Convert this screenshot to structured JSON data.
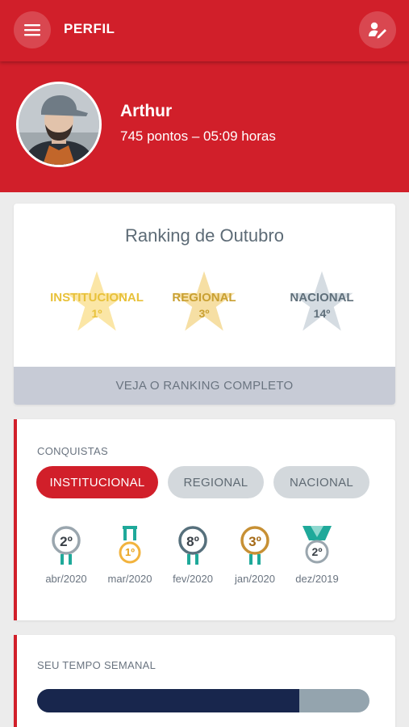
{
  "header": {
    "title": "PERFIL",
    "menu_icon": "hamburger-menu-icon",
    "edit_icon": "edit-profile-icon"
  },
  "profile": {
    "name": "Arthur",
    "stats": "745 pontos – 05:09 horas"
  },
  "ranking": {
    "title": "Ranking de Outubro",
    "items": [
      {
        "label": "INSTITUCIONAL",
        "position": "1º",
        "color": "#e8c13a"
      },
      {
        "label": "REGIONAL",
        "position": "3º",
        "color": "#c9a032"
      },
      {
        "label": "NACIONAL",
        "position": "14º",
        "color": "#6d7d88"
      }
    ],
    "button_label": "VEJA O RANKING COMPLETO"
  },
  "conquistas": {
    "title": "CONQUISTAS",
    "tabs": [
      {
        "label": "INSTITUCIONAL",
        "active": true
      },
      {
        "label": "REGIONAL",
        "active": false
      },
      {
        "label": "NACIONAL",
        "active": false
      }
    ],
    "medals": [
      {
        "rank": "2º",
        "date": "abr/2020",
        "ring": "#9aa6ae",
        "ribbon": "#1fa99a"
      },
      {
        "rank": "1º",
        "date": "mar/2020",
        "ring": "#f2b33d",
        "ribbon": "#1fa99a"
      },
      {
        "rank": "8º",
        "date": "fev/2020",
        "ring": "#56707c",
        "ribbon": "#1fa99a"
      },
      {
        "rank": "3º",
        "date": "jan/2020",
        "ring": "#c79034",
        "ribbon": "#1fa99a"
      },
      {
        "rank": "2º",
        "date": "dez/2019",
        "ring": "#9aa6ae",
        "ribbon": "#1fa99a"
      }
    ]
  },
  "tempo": {
    "title": "SEU TEMPO SEMANAL",
    "progress_fraction": 0.79
  },
  "colors": {
    "primary": "#d11f2a",
    "dark_navy": "#18264d"
  }
}
